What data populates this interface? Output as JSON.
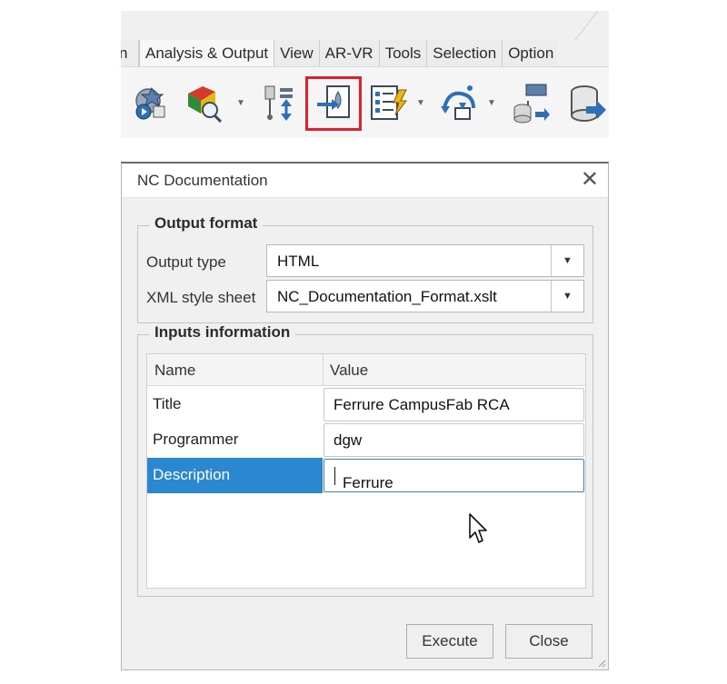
{
  "ribbon": {
    "tabs": [
      "n",
      "Analysis & Output",
      "View",
      "AR-VR",
      "Tools",
      "Selection",
      "Option"
    ],
    "highlight_color": "#e0202a",
    "icons": [
      "simulation-icon",
      "color-analysis-icon",
      "probe-icon",
      "nc-documentation-icon",
      "checklist-icon",
      "postprocess-icon",
      "database-icon",
      "export-icon"
    ]
  },
  "dialog": {
    "title": "NC Documentation",
    "output_format": {
      "legend": "Output format",
      "output_type_label": "Output type",
      "output_type_value": "HTML",
      "style_sheet_label": "XML style sheet",
      "style_sheet_value": "NC_Documentation_Format.xslt"
    },
    "inputs": {
      "legend": "Inputs information",
      "col_name": "Name",
      "col_value": "Value",
      "rows": [
        {
          "name": "Title",
          "value": "Ferrure CampusFab RCA"
        },
        {
          "name": "Programmer",
          "value": "dgw"
        },
        {
          "name": "Description",
          "value": "Ferrure"
        }
      ]
    },
    "execute_label": "Execute",
    "close_label": "Close",
    "selection_color": "#2b88d0"
  }
}
